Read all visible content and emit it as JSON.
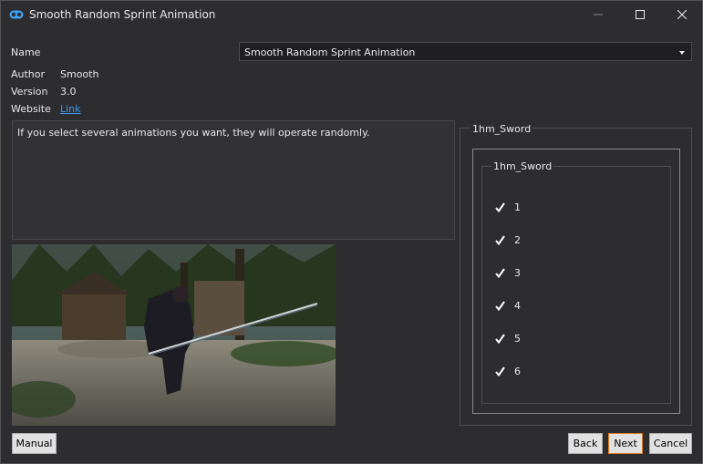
{
  "window": {
    "title": "Smooth Random Sprint Animation",
    "controls": [
      "minimize",
      "maximize",
      "close"
    ]
  },
  "form": {
    "name_label": "Name",
    "name_value": "Smooth Random Sprint Animation",
    "author_label": "Author",
    "author_value": "Smooth",
    "version_label": "Version",
    "version_value": "3.0",
    "website_label": "Website",
    "website_link": "Link"
  },
  "description": "If you select several animations you want, they will operate randomly.",
  "preview": {
    "icon": "game-screenshot"
  },
  "options": {
    "group_title": "1hm_Sword",
    "subgroup_title": "1hm_Sword",
    "items": [
      {
        "label": "1",
        "checked": true
      },
      {
        "label": "2",
        "checked": true
      },
      {
        "label": "3",
        "checked": true
      },
      {
        "label": "4",
        "checked": true
      },
      {
        "label": "5",
        "checked": true
      },
      {
        "label": "6",
        "checked": true
      }
    ]
  },
  "buttons": {
    "manual": "Manual",
    "back": "Back",
    "next": "Next",
    "cancel": "Cancel"
  },
  "colors": {
    "background": "#2d2d30",
    "link": "#3a9af5",
    "accent": "#e07a1f",
    "app_icon": "#3ba0f0"
  }
}
